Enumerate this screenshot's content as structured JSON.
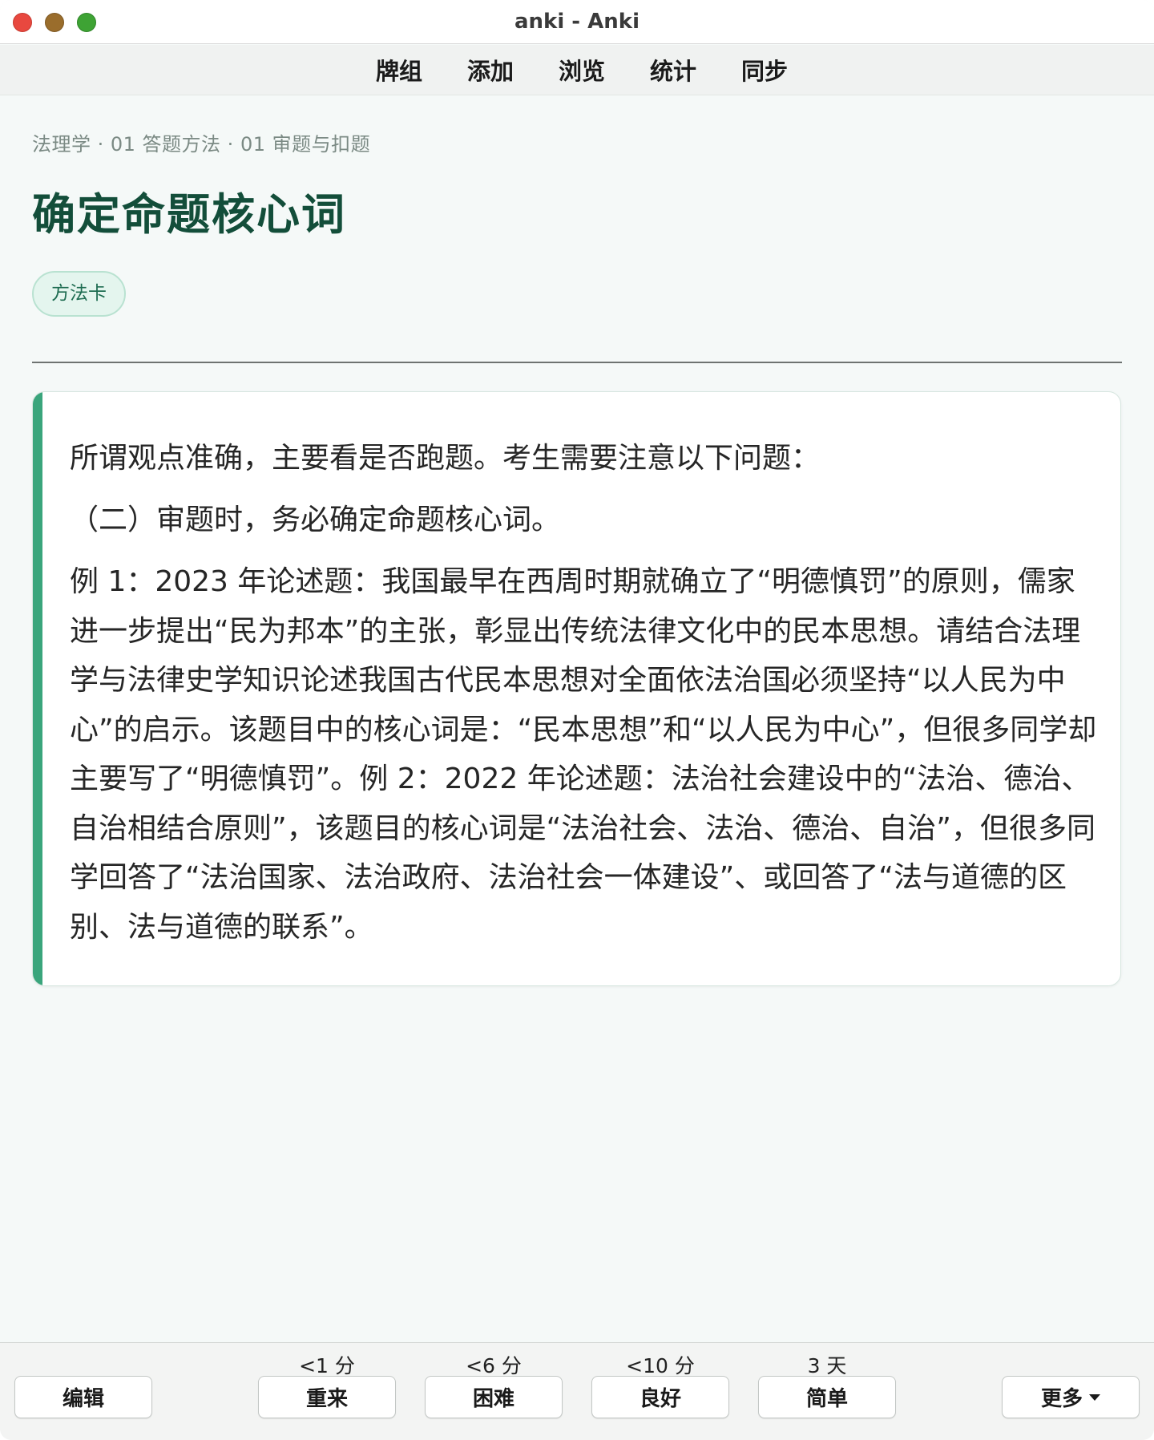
{
  "window": {
    "title": "anki - Anki"
  },
  "toolbar": {
    "items": [
      {
        "label": "牌组"
      },
      {
        "label": "添加"
      },
      {
        "label": "浏览"
      },
      {
        "label": "统计"
      },
      {
        "label": "同步"
      }
    ]
  },
  "card": {
    "breadcrumb": "法理学 · 01 答题方法 · 01 审题与扣题",
    "title": "确定命题核心词",
    "tag": "方法卡",
    "paragraphs": [
      "所谓观点准确，主要看是否跑题。考生需要注意以下问题：",
      "（二）审题时，务必确定命题核心词。",
      "例 1：2023 年论述题：我国最早在西周时期就确立了“明德慎罚”的原则，儒家进一步提出“民为邦本”的主张，彰显出传统法律文化中的民本思想。请结合法理学与法律史学知识论述我国古代民本思想对全面依法治国必须坚持“以人民为中心”的启示。该题目中的核心词是：“民本思想”和“以人民为中心”，但很多同学却主要写了“明德慎罚”。例 2：2022 年论述题：法治社会建设中的“法治、德治、自治相结合原则”，该题目的核心词是“法治社会、法治、德治、自治”，但很多同学回答了“法治国家、法治政府、法治社会一体建设”、或回答了“法与道德的区别、法与道德的联系”。"
    ]
  },
  "bottom": {
    "edit_label": "编辑",
    "more_label": "更多",
    "answers": [
      {
        "interval": "<1 分",
        "label": "重来"
      },
      {
        "interval": "<6 分",
        "label": "困难"
      },
      {
        "interval": "<10 分",
        "label": "良好"
      },
      {
        "interval": "3 天",
        "label": "简单"
      }
    ]
  },
  "colors": {
    "accent": "#3aa57c",
    "title": "#134e3a",
    "tag_bg": "#e4f5ee",
    "traffic_red": "#e8483f",
    "traffic_yellow": "#9a6d2c",
    "traffic_green": "#3ea334"
  }
}
